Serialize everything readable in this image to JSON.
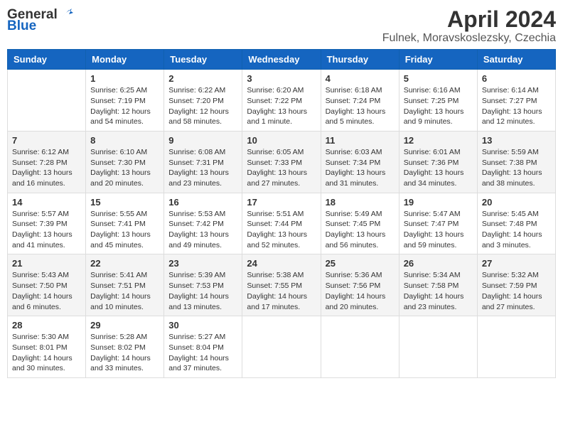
{
  "header": {
    "logo_general": "General",
    "logo_blue": "Blue",
    "month": "April 2024",
    "location": "Fulnek, Moravskoslezsky, Czechia"
  },
  "columns": [
    "Sunday",
    "Monday",
    "Tuesday",
    "Wednesday",
    "Thursday",
    "Friday",
    "Saturday"
  ],
  "weeks": [
    [
      {
        "day": "",
        "info": ""
      },
      {
        "day": "1",
        "info": "Sunrise: 6:25 AM\nSunset: 7:19 PM\nDaylight: 12 hours\nand 54 minutes."
      },
      {
        "day": "2",
        "info": "Sunrise: 6:22 AM\nSunset: 7:20 PM\nDaylight: 12 hours\nand 58 minutes."
      },
      {
        "day": "3",
        "info": "Sunrise: 6:20 AM\nSunset: 7:22 PM\nDaylight: 13 hours\nand 1 minute."
      },
      {
        "day": "4",
        "info": "Sunrise: 6:18 AM\nSunset: 7:24 PM\nDaylight: 13 hours\nand 5 minutes."
      },
      {
        "day": "5",
        "info": "Sunrise: 6:16 AM\nSunset: 7:25 PM\nDaylight: 13 hours\nand 9 minutes."
      },
      {
        "day": "6",
        "info": "Sunrise: 6:14 AM\nSunset: 7:27 PM\nDaylight: 13 hours\nand 12 minutes."
      }
    ],
    [
      {
        "day": "7",
        "info": "Sunrise: 6:12 AM\nSunset: 7:28 PM\nDaylight: 13 hours\nand 16 minutes."
      },
      {
        "day": "8",
        "info": "Sunrise: 6:10 AM\nSunset: 7:30 PM\nDaylight: 13 hours\nand 20 minutes."
      },
      {
        "day": "9",
        "info": "Sunrise: 6:08 AM\nSunset: 7:31 PM\nDaylight: 13 hours\nand 23 minutes."
      },
      {
        "day": "10",
        "info": "Sunrise: 6:05 AM\nSunset: 7:33 PM\nDaylight: 13 hours\nand 27 minutes."
      },
      {
        "day": "11",
        "info": "Sunrise: 6:03 AM\nSunset: 7:34 PM\nDaylight: 13 hours\nand 31 minutes."
      },
      {
        "day": "12",
        "info": "Sunrise: 6:01 AM\nSunset: 7:36 PM\nDaylight: 13 hours\nand 34 minutes."
      },
      {
        "day": "13",
        "info": "Sunrise: 5:59 AM\nSunset: 7:38 PM\nDaylight: 13 hours\nand 38 minutes."
      }
    ],
    [
      {
        "day": "14",
        "info": "Sunrise: 5:57 AM\nSunset: 7:39 PM\nDaylight: 13 hours\nand 41 minutes."
      },
      {
        "day": "15",
        "info": "Sunrise: 5:55 AM\nSunset: 7:41 PM\nDaylight: 13 hours\nand 45 minutes."
      },
      {
        "day": "16",
        "info": "Sunrise: 5:53 AM\nSunset: 7:42 PM\nDaylight: 13 hours\nand 49 minutes."
      },
      {
        "day": "17",
        "info": "Sunrise: 5:51 AM\nSunset: 7:44 PM\nDaylight: 13 hours\nand 52 minutes."
      },
      {
        "day": "18",
        "info": "Sunrise: 5:49 AM\nSunset: 7:45 PM\nDaylight: 13 hours\nand 56 minutes."
      },
      {
        "day": "19",
        "info": "Sunrise: 5:47 AM\nSunset: 7:47 PM\nDaylight: 13 hours\nand 59 minutes."
      },
      {
        "day": "20",
        "info": "Sunrise: 5:45 AM\nSunset: 7:48 PM\nDaylight: 14 hours\nand 3 minutes."
      }
    ],
    [
      {
        "day": "21",
        "info": "Sunrise: 5:43 AM\nSunset: 7:50 PM\nDaylight: 14 hours\nand 6 minutes."
      },
      {
        "day": "22",
        "info": "Sunrise: 5:41 AM\nSunset: 7:51 PM\nDaylight: 14 hours\nand 10 minutes."
      },
      {
        "day": "23",
        "info": "Sunrise: 5:39 AM\nSunset: 7:53 PM\nDaylight: 14 hours\nand 13 minutes."
      },
      {
        "day": "24",
        "info": "Sunrise: 5:38 AM\nSunset: 7:55 PM\nDaylight: 14 hours\nand 17 minutes."
      },
      {
        "day": "25",
        "info": "Sunrise: 5:36 AM\nSunset: 7:56 PM\nDaylight: 14 hours\nand 20 minutes."
      },
      {
        "day": "26",
        "info": "Sunrise: 5:34 AM\nSunset: 7:58 PM\nDaylight: 14 hours\nand 23 minutes."
      },
      {
        "day": "27",
        "info": "Sunrise: 5:32 AM\nSunset: 7:59 PM\nDaylight: 14 hours\nand 27 minutes."
      }
    ],
    [
      {
        "day": "28",
        "info": "Sunrise: 5:30 AM\nSunset: 8:01 PM\nDaylight: 14 hours\nand 30 minutes."
      },
      {
        "day": "29",
        "info": "Sunrise: 5:28 AM\nSunset: 8:02 PM\nDaylight: 14 hours\nand 33 minutes."
      },
      {
        "day": "30",
        "info": "Sunrise: 5:27 AM\nSunset: 8:04 PM\nDaylight: 14 hours\nand 37 minutes."
      },
      {
        "day": "",
        "info": ""
      },
      {
        "day": "",
        "info": ""
      },
      {
        "day": "",
        "info": ""
      },
      {
        "day": "",
        "info": ""
      }
    ]
  ]
}
